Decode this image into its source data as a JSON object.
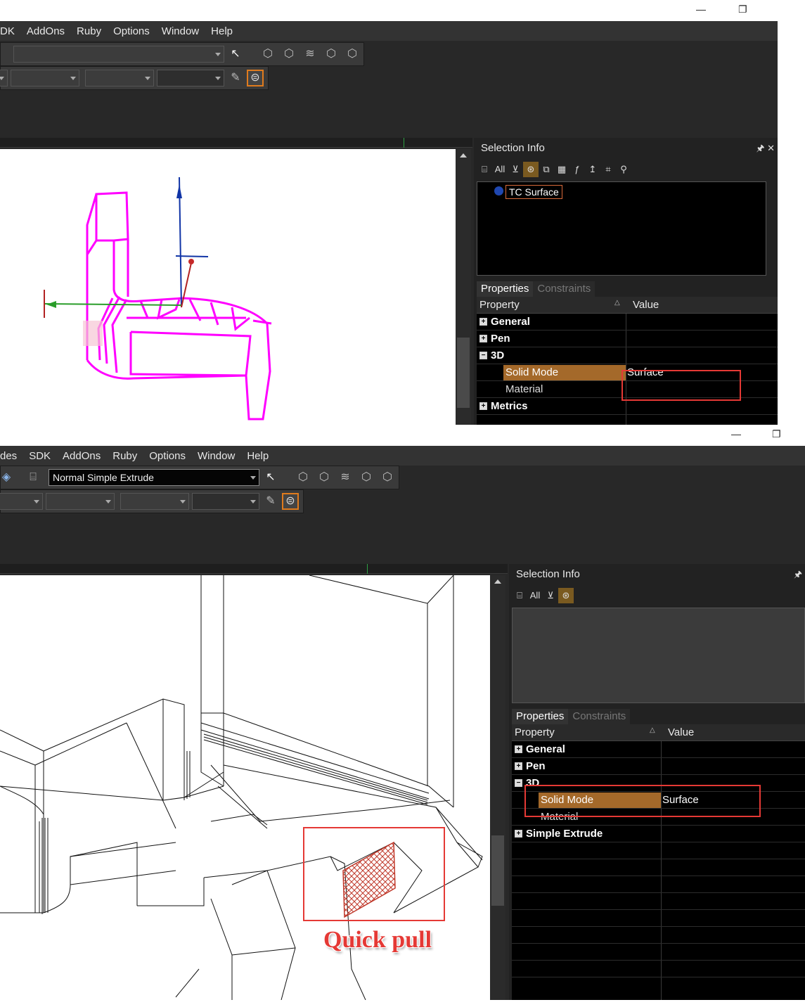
{
  "top": {
    "menu": [
      "DK",
      "AddOns",
      "Ruby",
      "Options",
      "Window",
      "Help"
    ],
    "window_buttons": {
      "minimize": "—",
      "maximize": "❐"
    },
    "selection_info": {
      "title": "Selection Info",
      "title_buttons": "🖈 ✕",
      "toolbar_all": "All",
      "tree_item": "TC Surface",
      "tabs": [
        "Properties",
        "Constraints"
      ],
      "header": {
        "property": "Property",
        "value": "Value",
        "sort": "△"
      },
      "rows": {
        "general": "General",
        "pen": "Pen",
        "three_d": "3D",
        "solid_mode": "Solid Mode",
        "solid_mode_value": "Surface",
        "material": "Material",
        "metrics": "Metrics"
      }
    }
  },
  "bottom": {
    "menu": [
      "des",
      "SDK",
      "AddOns",
      "Ruby",
      "Options",
      "Window",
      "Help"
    ],
    "window_buttons": {
      "minimize": "—",
      "maximize": "❐"
    },
    "tool_combo": "Normal Simple Extrude",
    "selection_info": {
      "title": "Selection Info",
      "title_buttons": "🖈",
      "toolbar_all": "All",
      "tabs": [
        "Properties",
        "Constraints"
      ],
      "header": {
        "property": "Property",
        "value": "Value",
        "sort": "△"
      },
      "rows": {
        "general": "General",
        "pen": "Pen",
        "three_d": "3D",
        "solid_mode": "Solid Mode",
        "solid_mode_value": "Surface",
        "material": "Material",
        "simple_extrude": "Simple Extrude"
      }
    },
    "annotation": "Quick pull"
  },
  "colors": {
    "accent_orange": "#e07b1d",
    "selection_fill": "#a4692a",
    "highlight_red": "#e53935",
    "wire_magenta": "#ff00ff"
  }
}
